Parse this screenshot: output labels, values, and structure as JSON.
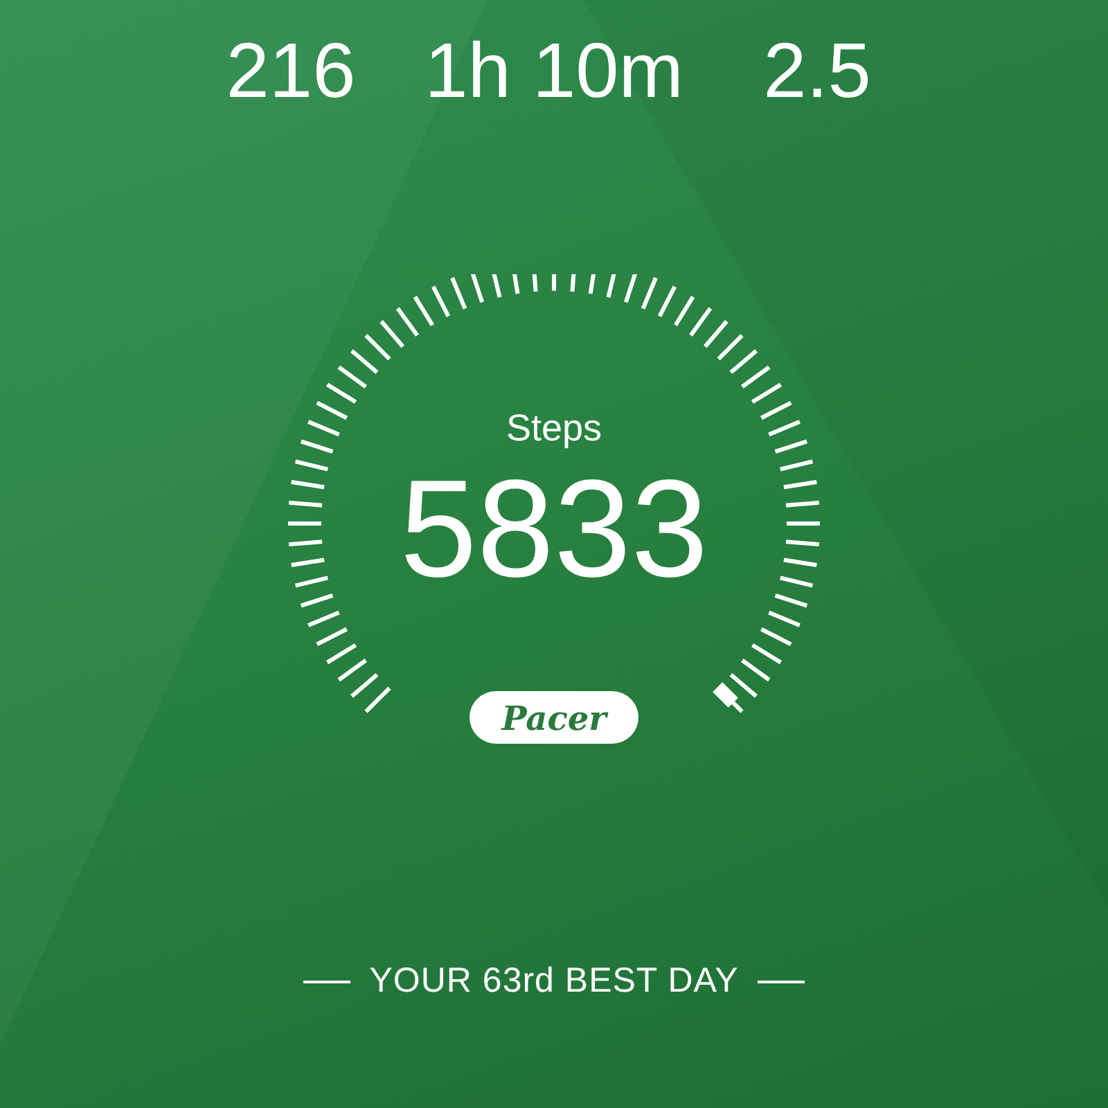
{
  "stats": [
    {
      "value": "216"
    },
    {
      "value": "1h 10m"
    },
    {
      "value": "2.5"
    }
  ],
  "steps": {
    "label": "Steps",
    "value": "5833"
  },
  "logo": "Pacer",
  "footer": "YOUR 63rd BEST DAY"
}
